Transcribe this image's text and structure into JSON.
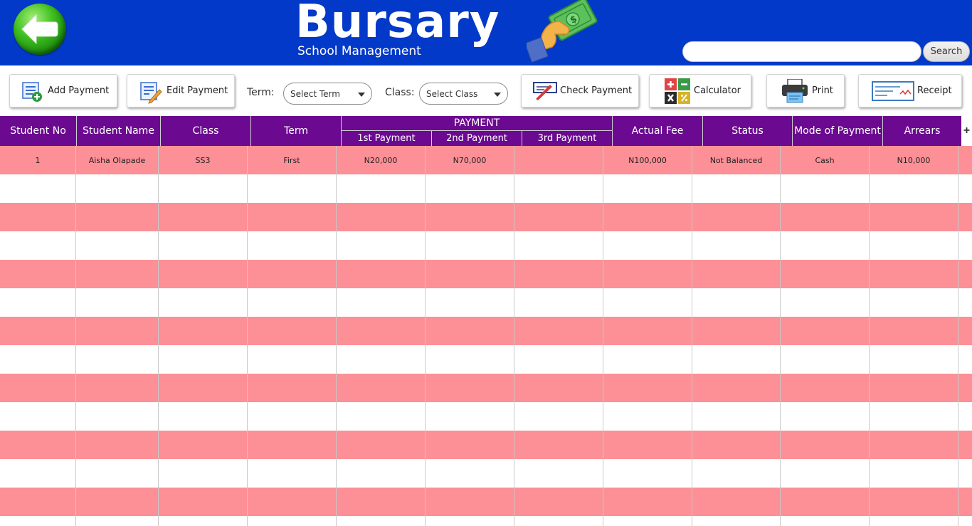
{
  "header": {
    "title": "Bursary",
    "subtitle": "School Management",
    "back_icon": "back-arrow-icon",
    "money_icon": "money-hand-icon",
    "search": {
      "placeholder": "",
      "value": "",
      "button_label": "Search"
    }
  },
  "toolbar": {
    "add_payment": "Add Payment",
    "edit_payment": "Edit Payment",
    "term_label": "Term:",
    "term_select": "Select Term",
    "class_label": "Class:",
    "class_select": "Select Class",
    "check_payment": "Check Payment",
    "calculator": "Calculator",
    "print": "Print",
    "receipt": "Receipt"
  },
  "table": {
    "headers": {
      "student_no": "Student No",
      "student_name": "Student Name",
      "class": "Class",
      "term": "Term",
      "payment_group": "PAYMENT",
      "first_payment": "1st Payment",
      "second_payment": "2nd Payment",
      "third_payment": "3rd Payment",
      "actual_fee": "Actual Fee",
      "status": "Status",
      "mode_of_payment": "Mode of Payment",
      "arrears": "Arrears",
      "add_column": "+"
    },
    "rows": [
      {
        "student_no": "1",
        "student_name": "Aisha Olapade",
        "class": "SS3",
        "term": "First",
        "first_payment": "N20,000",
        "second_payment": "N70,000",
        "third_payment": "",
        "actual_fee": "N100,000",
        "status": "Not Balanced",
        "mode_of_payment": "Cash",
        "arrears": "N10,000"
      }
    ]
  },
  "colors": {
    "header_bg": "#0339c8",
    "table_header_bg": "#6b0a90",
    "row_pink": "#fd8f96",
    "row_white": "#ffffff"
  }
}
